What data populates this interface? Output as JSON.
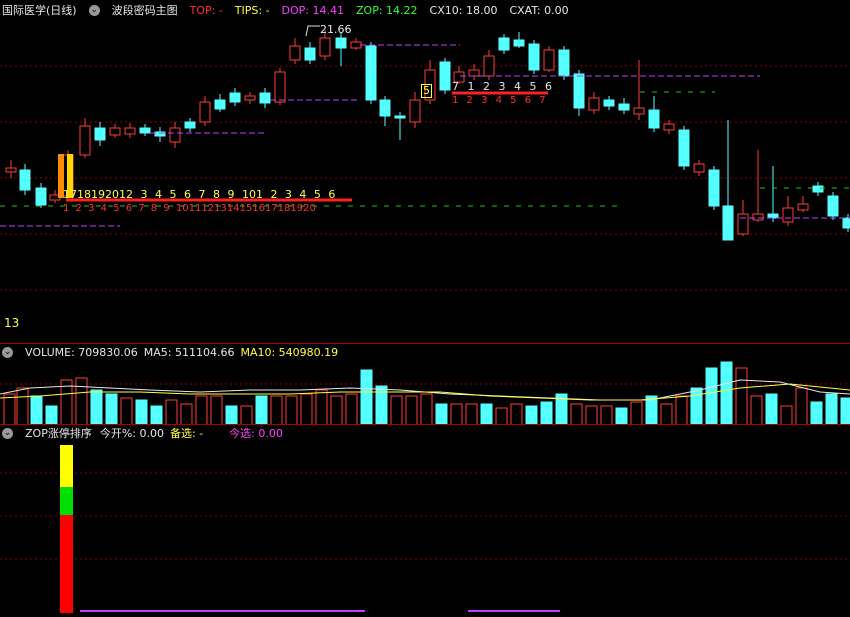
{
  "main": {
    "title": "国际医学(日线)",
    "indicator": "波段密码主图",
    "top_label": "TOP: -",
    "tips_label": "TIPS: -",
    "dop_label": "DOP: 14.41",
    "zop_label": "ZOP: 14.22",
    "cx10_label": "CX10: 18.00",
    "cxat_label": "CXAT: 0.00",
    "high_marker": "21.66",
    "bottom_left_value": "13",
    "marker_5": "5",
    "count_row_a_top": "1718192012 3 4 5 6 7 8 9 101 2 3 4 5 6",
    "count_row_a_bottom": "1 2 3 4 5 6 7 8 9 1011121314151617181920",
    "count_row_b_top": "7 1 2 3 4 5 6",
    "count_row_b_bottom": "1 2 3 4 5 6 7"
  },
  "volume": {
    "label": "VOLUME: 709830.06",
    "ma5": "MA5: 511104.66",
    "ma10": "MA10: 540980.19"
  },
  "zop": {
    "title": "ZOP涨停排序",
    "today_open": "今开%: 0.00",
    "candidate": "备选: -",
    "today_pick": "今选: 0.00"
  },
  "colors": {
    "up": "#ff3b3b",
    "down": "#54ffff",
    "ma5": "#e8e8e8",
    "ma10": "#ffff40",
    "purple": "#c040ff",
    "green_dash": "#20c020",
    "grid": "#8b0000"
  }
}
